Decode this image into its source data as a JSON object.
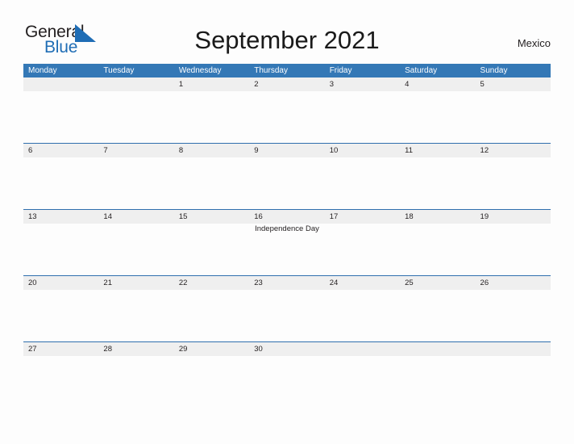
{
  "brand": {
    "name_part1": "General",
    "name_part2": "Blue",
    "triangle_icon": "triangle-icon",
    "color_dark": "#231f20",
    "color_blue": "#1f6db5"
  },
  "header": {
    "title": "September 2021",
    "country": "Mexico"
  },
  "theme": {
    "header_blue": "#3478b6",
    "rule_blue": "#2f6fae",
    "band_gray": "#efefef",
    "page_background": "#fdfdfd",
    "text": "#231f20"
  },
  "calendar": {
    "month": "September",
    "year": "2021",
    "weekday_headers": [
      "Monday",
      "Tuesday",
      "Wednesday",
      "Thursday",
      "Friday",
      "Saturday",
      "Sunday"
    ],
    "weeks": [
      {
        "days": [
          {
            "number": "",
            "events": []
          },
          {
            "number": "",
            "events": []
          },
          {
            "number": "1",
            "events": []
          },
          {
            "number": "2",
            "events": []
          },
          {
            "number": "3",
            "events": []
          },
          {
            "number": "4",
            "events": []
          },
          {
            "number": "5",
            "events": []
          }
        ]
      },
      {
        "days": [
          {
            "number": "6",
            "events": []
          },
          {
            "number": "7",
            "events": []
          },
          {
            "number": "8",
            "events": []
          },
          {
            "number": "9",
            "events": []
          },
          {
            "number": "10",
            "events": []
          },
          {
            "number": "11",
            "events": []
          },
          {
            "number": "12",
            "events": []
          }
        ]
      },
      {
        "days": [
          {
            "number": "13",
            "events": []
          },
          {
            "number": "14",
            "events": []
          },
          {
            "number": "15",
            "events": []
          },
          {
            "number": "16",
            "events": [
              "Independence Day"
            ]
          },
          {
            "number": "17",
            "events": []
          },
          {
            "number": "18",
            "events": []
          },
          {
            "number": "19",
            "events": []
          }
        ]
      },
      {
        "days": [
          {
            "number": "20",
            "events": []
          },
          {
            "number": "21",
            "events": []
          },
          {
            "number": "22",
            "events": []
          },
          {
            "number": "23",
            "events": []
          },
          {
            "number": "24",
            "events": []
          },
          {
            "number": "25",
            "events": []
          },
          {
            "number": "26",
            "events": []
          }
        ]
      },
      {
        "days": [
          {
            "number": "27",
            "events": []
          },
          {
            "number": "28",
            "events": []
          },
          {
            "number": "29",
            "events": []
          },
          {
            "number": "30",
            "events": []
          },
          {
            "number": "",
            "events": []
          },
          {
            "number": "",
            "events": []
          },
          {
            "number": "",
            "events": []
          }
        ]
      }
    ]
  }
}
